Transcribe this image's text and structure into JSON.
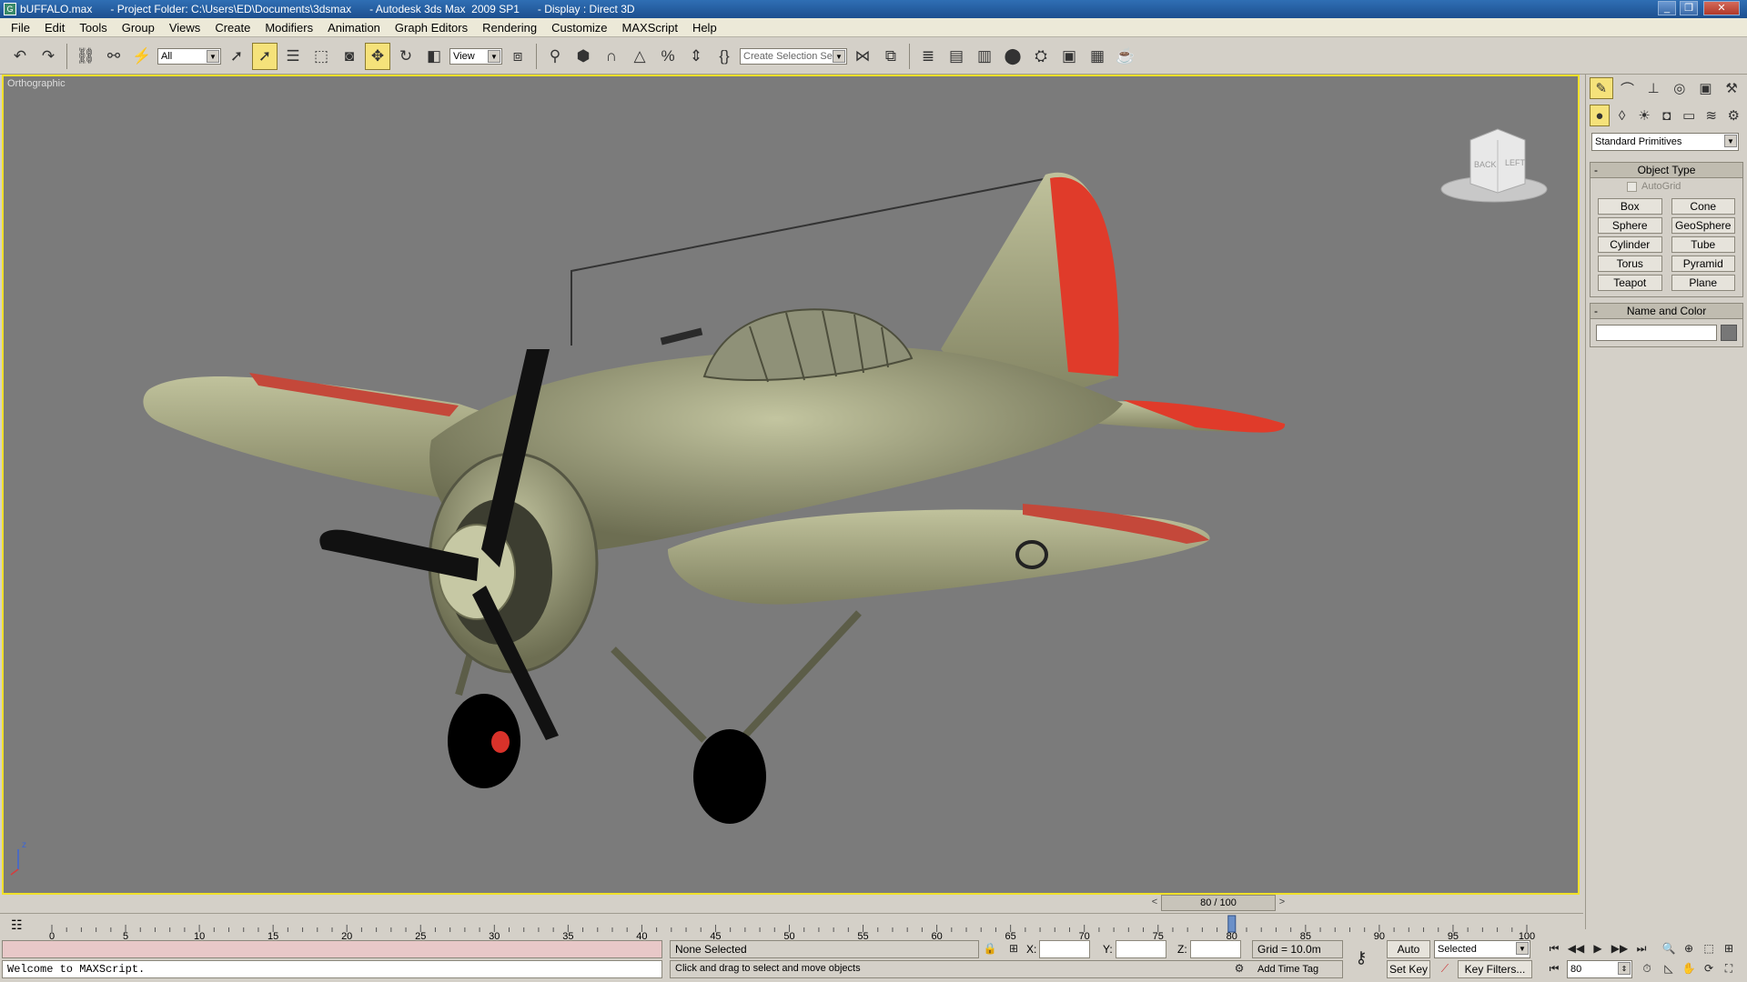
{
  "title_bar": {
    "text": "bUFFALO.max      - Project Folder: C:\\Users\\ED\\Documents\\3dsmax      - Autodesk 3ds Max  2009 SP1      - Display : Direct 3D",
    "app_icon": "G"
  },
  "menu": [
    "File",
    "Edit",
    "Tools",
    "Group",
    "Views",
    "Create",
    "Modifiers",
    "Animation",
    "Graph Editors",
    "Rendering",
    "Customize",
    "MAXScript",
    "Help"
  ],
  "toolbar": {
    "filter_value": "All",
    "coord_system_value": "View",
    "named_selection_placeholder": "Create Selection Set"
  },
  "viewport": {
    "label": "Orthographic",
    "viewcube": {
      "back": "BACK",
      "left": "LEFT"
    },
    "axis_label": "z",
    "colors": {
      "background": "#7b7b7b",
      "border": "#f0e02a",
      "body": "#a3a57f",
      "accent": "#e03b2a"
    }
  },
  "command_panel": {
    "category_value": "Standard Primitives",
    "object_type_title": "Object Type",
    "collapse_symbol": "-",
    "autogrid_label": "AutoGrid",
    "primitives": [
      "Box",
      "Cone",
      "Sphere",
      "GeoSphere",
      "Cylinder",
      "Tube",
      "Torus",
      "Pyramid",
      "Teapot",
      "Plane"
    ],
    "name_color_title": "Name and Color",
    "name_value": ""
  },
  "timeline": {
    "slider_text": "80 / 100",
    "ticks": [
      "0",
      "5",
      "10",
      "15",
      "20",
      "25",
      "30",
      "35",
      "40",
      "45",
      "50",
      "55",
      "60",
      "65",
      "70",
      "75",
      "80",
      "85",
      "90",
      "95",
      "100"
    ],
    "current_frame": 80,
    "total_frames": 100
  },
  "status": {
    "maxscript_listener_top": "",
    "maxscript_listener": "Welcome to MAXScript.",
    "selection_status": "None Selected",
    "prompt": "Click and drag to select and move objects",
    "x_label": "X:",
    "y_label": "Y:",
    "z_label": "Z:",
    "x_value": "",
    "y_value": "",
    "z_value": "",
    "grid": "Grid = 10.0m",
    "add_time_tag": "Add Time Tag",
    "auto_key": "Auto Key",
    "set_key": "Set Key",
    "key_mode_value": "Selected",
    "key_filters": "Key Filters...",
    "frame_value": "80"
  }
}
